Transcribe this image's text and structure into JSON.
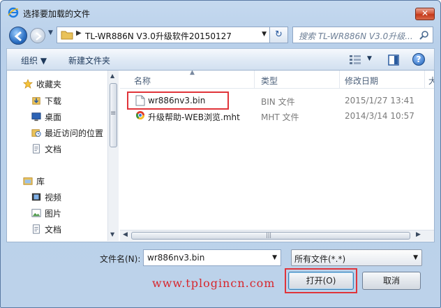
{
  "window": {
    "title": "选择要加载的文件",
    "close": "✕"
  },
  "address": {
    "path": "TL-WR886N V3.0升级软件20150127",
    "search_placeholder": "搜索 TL-WR886N V3.0升级..."
  },
  "toolbar": {
    "organize": "组织 ▼",
    "new_folder": "新建文件夹",
    "help": "?"
  },
  "nav": {
    "favorites": "收藏夹",
    "items": [
      "下载",
      "桌面",
      "最近访问的位置",
      "文档"
    ],
    "library": "库",
    "library_items": [
      "视频",
      "图片",
      "文档"
    ]
  },
  "columns": {
    "name": "名称",
    "type": "类型",
    "date": "修改日期",
    "size": "大"
  },
  "files": [
    {
      "name": "wr886nv3.bin",
      "type": "BIN 文件",
      "date": "2015/1/27 13:41"
    },
    {
      "name": "升级帮助-WEB浏览.mht",
      "type": "MHT 文件",
      "date": "2014/3/14 10:57"
    }
  ],
  "footer": {
    "filename_label": "文件名(N):",
    "filename_value": "wr886nv3.bin",
    "filter_value": "所有文件(*.*)",
    "watermark": "www.tplogincn.com",
    "open": "打开(O)",
    "cancel": "取消"
  },
  "colors": {
    "highlight": "#e0343a",
    "accent": "#2b6fc2"
  }
}
